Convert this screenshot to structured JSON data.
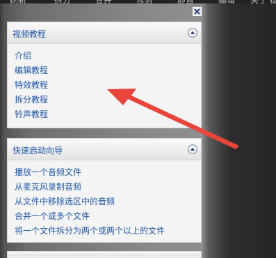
{
  "top_menu": [
    "刷新",
    "拆分",
    "合并",
    "修剪",
    "静音",
    "编辑",
    "关于",
    "提"
  ],
  "icons": {
    "close": "close-icon",
    "collapse": "chevron-up-icon",
    "annotation": "red-arrow-icon"
  },
  "colors": {
    "link": "#1f56a6",
    "annotation_arrow": "#e8453c"
  },
  "panels": [
    {
      "title": "视频教程",
      "items": [
        "介绍",
        "编辑教程",
        "特效教程",
        "拆分教程",
        "铃声教程"
      ]
    },
    {
      "title": "快速启动向导",
      "items": [
        "播放一个音频文件",
        "从麦克风录制音频",
        "从文件中移除选区中的音频",
        "合并一个或多个文件",
        "将一个文件拆分为两个或两个以上的文件"
      ]
    }
  ]
}
